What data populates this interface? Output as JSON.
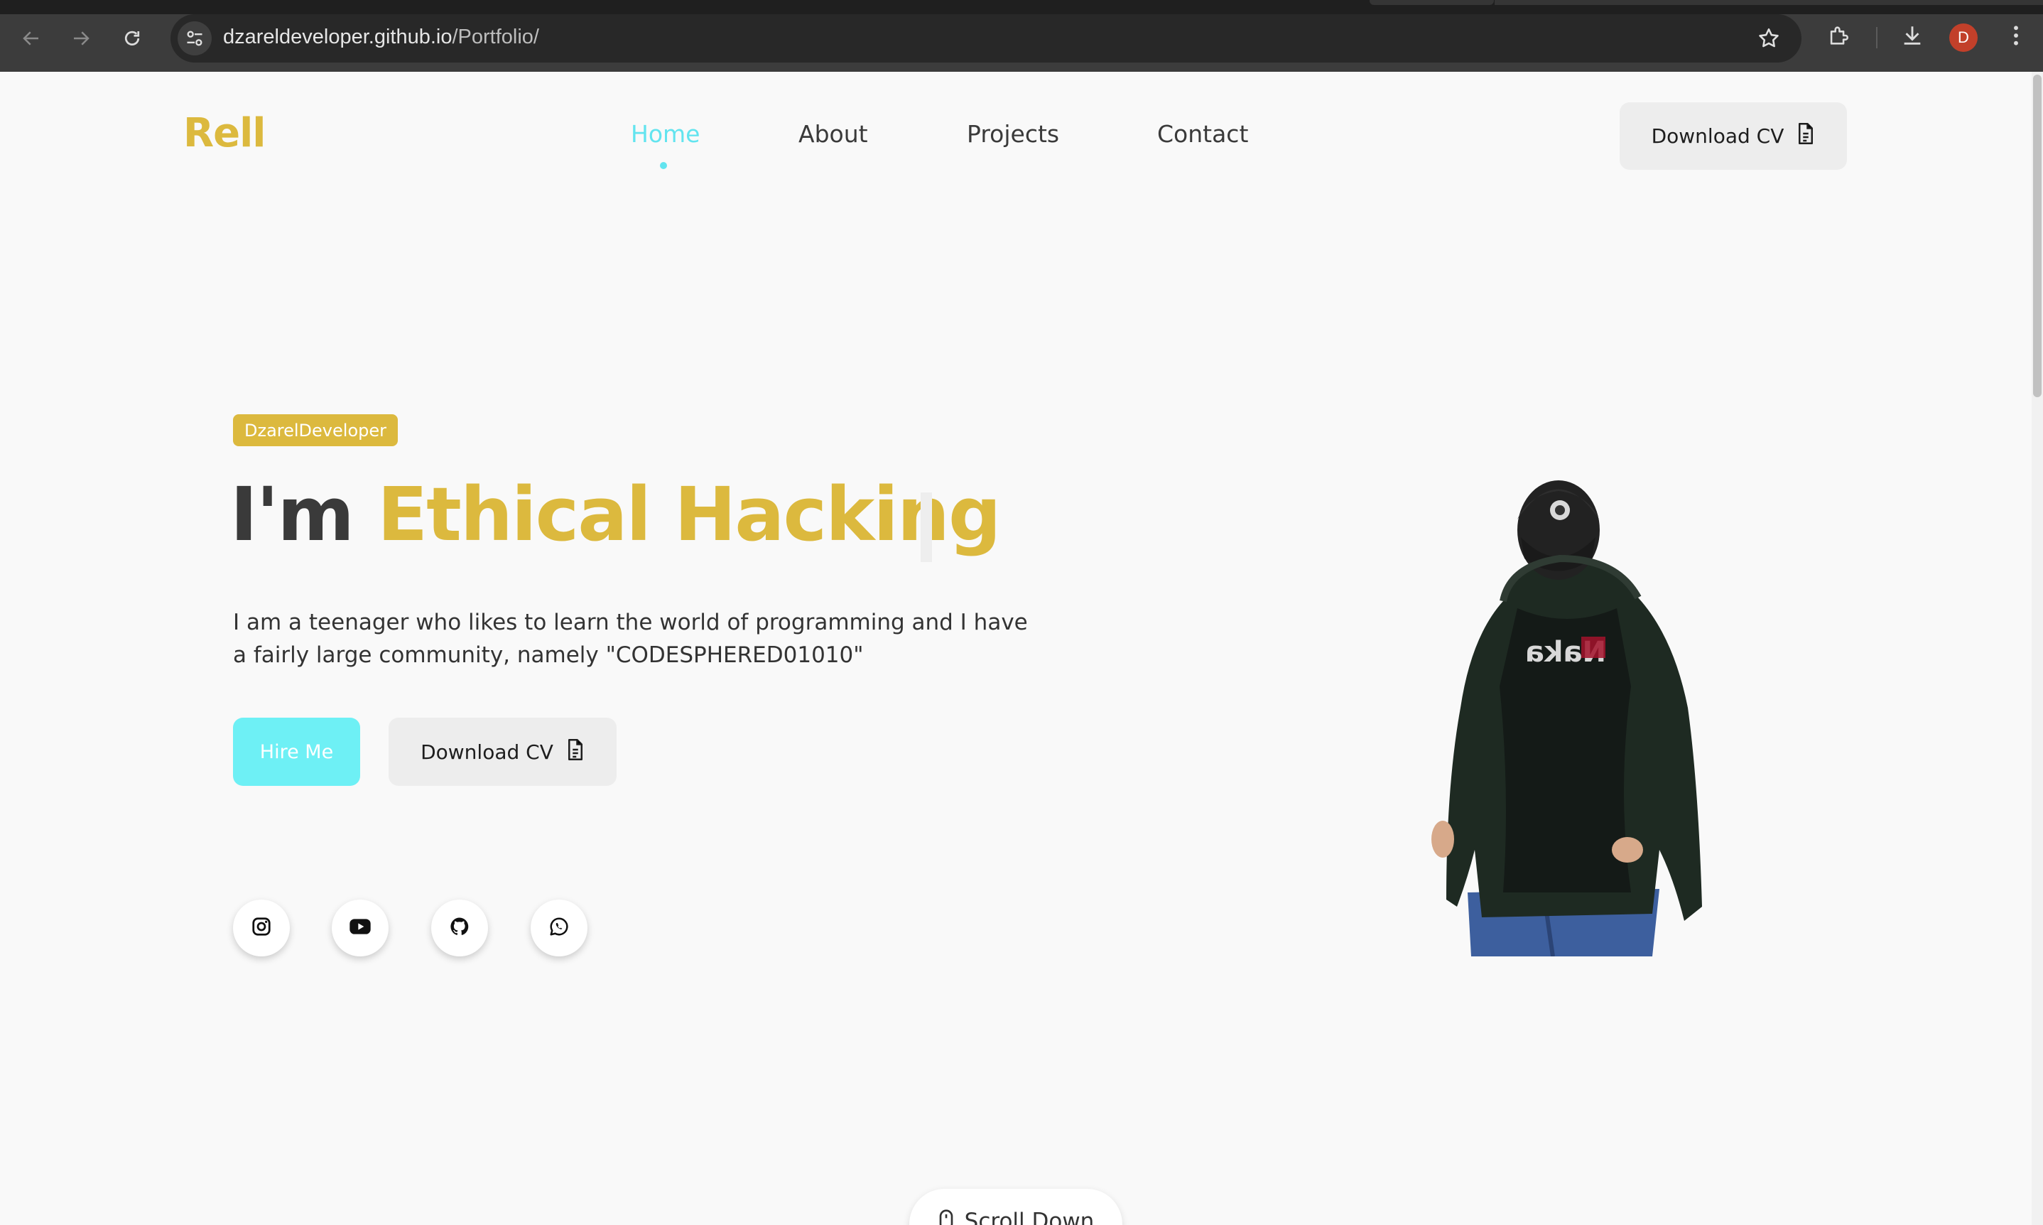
{
  "browser": {
    "url_host": "dzareldeveloper.github.io",
    "url_path": "/Portfolio/",
    "profile_initial": "D",
    "icons": [
      "back-arrow-icon",
      "forward-arrow-icon",
      "reload-icon",
      "site-info-icon",
      "bookmark-star-icon",
      "extensions-icon",
      "download-icon",
      "kebab-menu-icon"
    ]
  },
  "header": {
    "logo": "Rell",
    "nav": [
      {
        "label": "Home",
        "active": true
      },
      {
        "label": "About",
        "active": false
      },
      {
        "label": "Projects",
        "active": false
      },
      {
        "label": "Contact",
        "active": false
      }
    ],
    "cv_label": "Download CV"
  },
  "hero": {
    "badge": "DzarelDeveloper",
    "headline_prefix": "I'm",
    "headline_highlight": "Ethical Hacking",
    "description": "I am a teenager who likes to learn the world of programming and I have a fairly large community, namely \"CODESPHERED01010\"",
    "hire_label": "Hire Me",
    "cv_label": "Download CV",
    "socials": [
      "instagram-icon",
      "youtube-icon",
      "github-icon",
      "whatsapp-icon"
    ],
    "scroll_label": "Scroll Down"
  },
  "colors": {
    "accent_gold": "#dcb93e",
    "accent_cyan": "#62e4ef",
    "button_gray": "#ededed"
  }
}
